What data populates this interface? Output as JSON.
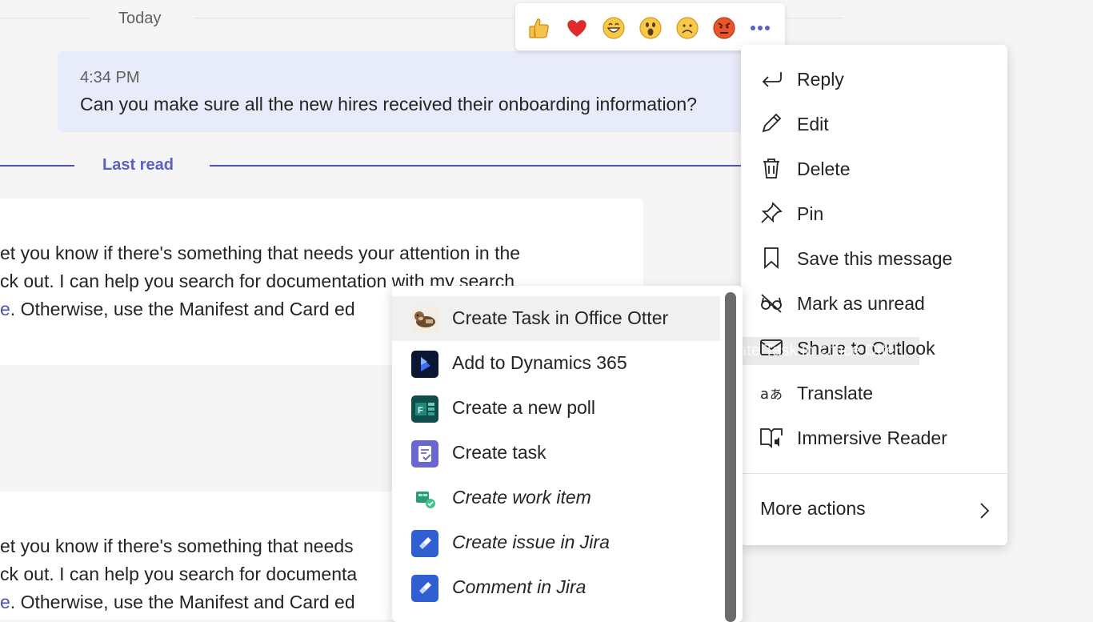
{
  "timeline": {
    "today_label": "Today",
    "last_read_label": "Last read"
  },
  "my_message": {
    "time": "4:34 PM",
    "text": "Can you make sure all the new hires received their onboarding information?"
  },
  "bot_messages": [
    {
      "lines": [
        "et you know if there's something that needs your attention in the",
        "ck out. I can help you search for documentation with my search"
      ],
      "line3_link": "e",
      "line3_rest": ". Otherwise, use the Manifest and Card ed"
    },
    {
      "lines": [
        "et you know if there's something that needs",
        "ck out. I can help you search for documenta"
      ],
      "line3_link": "e",
      "line3_rest": ". Otherwise, use the Manifest and Card ed"
    }
  ],
  "reactions": [
    {
      "name": "like",
      "icon": "thumbs-up-icon",
      "glyph": "👍"
    },
    {
      "name": "heart",
      "icon": "heart-icon",
      "glyph": "❤"
    },
    {
      "name": "laugh",
      "icon": "laugh-icon",
      "glyph": ""
    },
    {
      "name": "surprised",
      "icon": "surprised-icon",
      "glyph": ""
    },
    {
      "name": "sad",
      "icon": "sad-icon",
      "glyph": ""
    },
    {
      "name": "angry",
      "icon": "angry-icon",
      "glyph": ""
    }
  ],
  "context_menu": {
    "items": [
      {
        "label": "Reply",
        "icon": "reply-icon"
      },
      {
        "label": "Edit",
        "icon": "pencil-icon"
      },
      {
        "label": "Delete",
        "icon": "trash-icon"
      },
      {
        "label": "Pin",
        "icon": "pin-icon"
      },
      {
        "label": "Save this message",
        "icon": "bookmark-icon"
      },
      {
        "label": "Mark as unread",
        "icon": "glasses-off-icon"
      },
      {
        "label": "Share to Outlook",
        "icon": "mail-icon"
      },
      {
        "label": "Translate",
        "icon": "translate-icon"
      },
      {
        "label": "Immersive Reader",
        "icon": "immersive-reader-icon"
      }
    ],
    "more_actions_label": "More actions"
  },
  "tooltip": {
    "text": "Create Task in Office Otter"
  },
  "submenu": {
    "items": [
      {
        "label": "Create Task in Office Otter",
        "italic": false,
        "icon": "office-otter-icon"
      },
      {
        "label": "Add to Dynamics 365",
        "italic": false,
        "icon": "dynamics-365-icon"
      },
      {
        "label": "Create a new poll",
        "italic": false,
        "icon": "forms-poll-icon"
      },
      {
        "label": "Create task",
        "italic": false,
        "icon": "task-icon"
      },
      {
        "label": "Create work item",
        "italic": true,
        "icon": "work-item-icon"
      },
      {
        "label": "Create issue in Jira",
        "italic": true,
        "icon": "jira-icon"
      },
      {
        "label": "Comment in Jira",
        "italic": true,
        "icon": "jira-icon"
      }
    ]
  },
  "colors": {
    "accent": "#5b5fc7",
    "bubble": "#e8ebfa",
    "background": "#f5f5f5"
  }
}
